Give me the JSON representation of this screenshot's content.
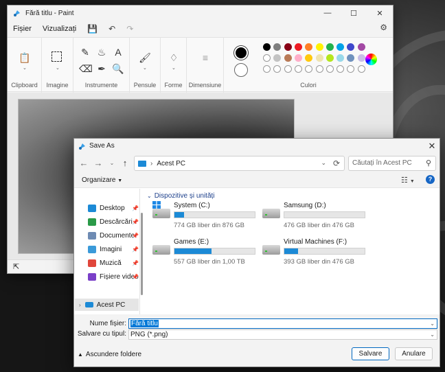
{
  "paint": {
    "title": "Fără titlu - Paint",
    "menu": [
      "Fișier",
      "Vizualizați"
    ],
    "groups": {
      "clipboard": "Clipboard",
      "imagine": "Imagine",
      "instrumente": "Instrumente",
      "pensule": "Pensule",
      "forme": "Forme",
      "dimensiune": "Dimensiune",
      "culori": "Culori"
    },
    "colors": {
      "primary": "#000000",
      "secondary": "#ffffff",
      "row1": [
        "#000000",
        "#7f7f7f",
        "#880015",
        "#ed1c24",
        "#ff7f27",
        "#fff200",
        "#22b14c",
        "#00a2e8",
        "#3f48cc",
        "#a349a4"
      ],
      "row2": [
        "#ffffff",
        "#c3c3c3",
        "#b97a57",
        "#ffaec9",
        "#ffc90e",
        "#efe4b0",
        "#b5e61d",
        "#99d9ea",
        "#7092be",
        "#c8bfe7"
      ]
    }
  },
  "dialog": {
    "title": "Save As",
    "address": "Acest PC",
    "search_placeholder": "Căutați în Acest PC",
    "organize": "Organizare",
    "nav_items": [
      {
        "label": "Desktop",
        "color": "#1c8ad6"
      },
      {
        "label": "Descărcări",
        "color": "#2a9a48"
      },
      {
        "label": "Documente",
        "color": "#6e8bb3"
      },
      {
        "label": "Imagini",
        "color": "#3a9ad9"
      },
      {
        "label": "Muzică",
        "color": "#e0463b"
      },
      {
        "label": "Fișiere video",
        "color": "#7a3fc8"
      }
    ],
    "nav_selected": "Acest PC",
    "group_header": "Dispozitive și unități",
    "drives": [
      {
        "name": "System (C:)",
        "free": "774 GB liber din 876 GB",
        "used": 0.12
      },
      {
        "name": "Samsung (D:)",
        "free": "476 GB liber din 476 GB",
        "used": 0.0
      },
      {
        "name": "Games (E:)",
        "free": "557 GB liber din 1,00 TB",
        "used": 0.46
      },
      {
        "name": "Virtual Machines (F:)",
        "free": "393 GB liber din 476 GB",
        "used": 0.17
      }
    ],
    "filename_label": "Nume fișier:",
    "filename_value": "Fără titlu",
    "type_label": "Salvare cu tipul:",
    "type_value": "PNG (*.png)",
    "hide_folders": "Ascundere foldere",
    "save_button": "Salvare",
    "cancel_button": "Anulare"
  }
}
